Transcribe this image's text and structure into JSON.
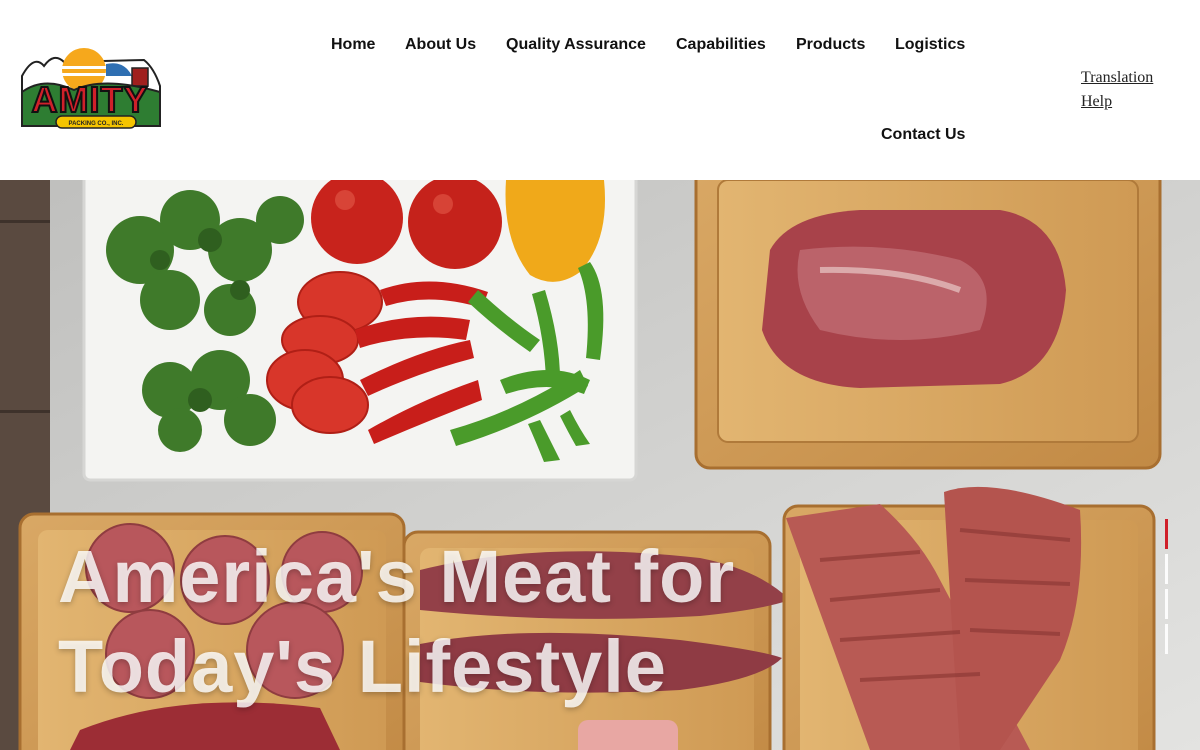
{
  "brand": {
    "logo_text": "AMITY",
    "logo_subtext": "PACKING CO., INC.",
    "colors": {
      "red": "#d0202a",
      "yellow": "#f5c400",
      "green": "#2e7d32",
      "sun": "#f6a81c",
      "sky": "#2f6fb2"
    }
  },
  "nav": {
    "items": [
      "Home",
      "About Us",
      "Quality Assurance",
      "Capabilities",
      "Products",
      "Logistics",
      "Contact Us"
    ]
  },
  "utility": {
    "translation": "Translation",
    "help": "Help"
  },
  "hero": {
    "headline_line1": "America's Meat for",
    "headline_line2": "Today's Lifestyle",
    "slide_count": 4,
    "active_slide": 1,
    "active_color": "#d0202a"
  }
}
